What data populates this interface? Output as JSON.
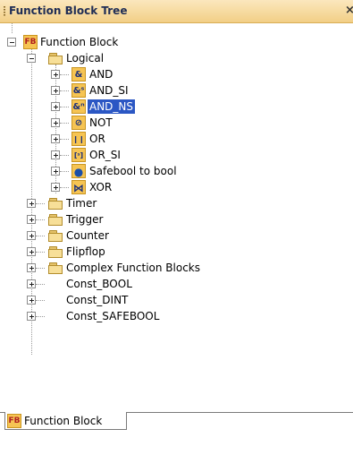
{
  "panel": {
    "title": "Function Block Tree",
    "close_glyph": "×",
    "bottom_tab": {
      "icon_text": "FB",
      "label": "Function Block"
    }
  },
  "tree": {
    "root": {
      "icon_text": "FB",
      "label": "Function Block",
      "expanded": true
    },
    "logical": {
      "label": "Logical",
      "expanded": true,
      "items": [
        {
          "label": "AND",
          "icon": "and-icon",
          "glyph": "&"
        },
        {
          "label": "AND_SI",
          "icon": "and-si-icon",
          "glyph": "&ˢ"
        },
        {
          "label": "AND_NS",
          "icon": "and-ns-icon",
          "glyph": "&ⁿ",
          "selected": true
        },
        {
          "label": "NOT",
          "icon": "not-icon",
          "glyph": "⊘"
        },
        {
          "label": "OR",
          "icon": "or-icon",
          "glyph": "❙❙"
        },
        {
          "label": "OR_SI",
          "icon": "or-si-icon",
          "glyph": "[ˢ]"
        },
        {
          "label": "Safebool to bool",
          "icon": "safebool-icon",
          "glyph": "●"
        },
        {
          "label": "XOR",
          "icon": "xor-icon",
          "glyph": "⋈"
        }
      ]
    },
    "folders": [
      "Timer",
      "Trigger",
      "Counter",
      "Flipflop",
      "Complex Function Blocks"
    ],
    "constants": [
      "Const_BOOL",
      "Const_DINT",
      "Const_SAFEBOOL"
    ]
  },
  "colors": {
    "title_bar": "#f2cf86",
    "selection": "#2b57c4",
    "fb_icon": "#f6c453",
    "folder": "#f7df98"
  }
}
